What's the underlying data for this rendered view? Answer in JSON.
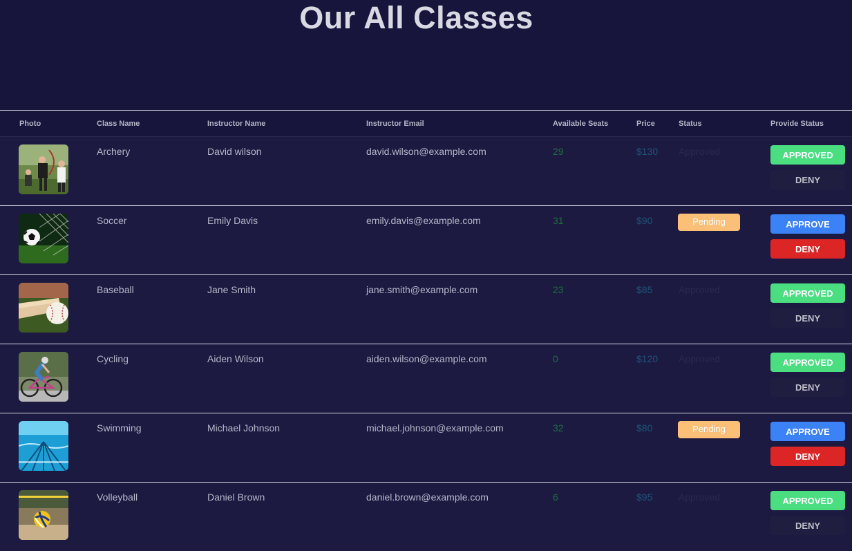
{
  "page_title": "Our All Classes",
  "columns": [
    "Photo",
    "Class Name",
    "Instructor Name",
    "Instructor Email",
    "Available Seats",
    "Price",
    "Status",
    "Provide Status"
  ],
  "colors": {
    "background": "#17153b",
    "row_background": "#1d1a42",
    "approved_button": "#4ade80",
    "approve_button": "#3b82f6",
    "deny_button": "#dc2626",
    "pending_badge": "#fbbf77",
    "seats_text": "#1f6e3e",
    "price_text": "#1c5578"
  },
  "rows": [
    {
      "photo_icon": "archery-photo",
      "class_name": "Archery",
      "instructor": "David wilson",
      "email": "david.wilson@example.com",
      "seats": "29",
      "price": "$130",
      "status": "Approved",
      "approve_label": "APPROVED",
      "deny_label": "DENY"
    },
    {
      "photo_icon": "soccer-photo",
      "class_name": "Soccer",
      "instructor": "Emily Davis",
      "email": "emily.davis@example.com",
      "seats": "31",
      "price": "$90",
      "status": "Pending",
      "approve_label": "APPROVE",
      "deny_label": "DENY"
    },
    {
      "photo_icon": "baseball-photo",
      "class_name": "Baseball",
      "instructor": "Jane Smith",
      "email": "jane.smith@example.com",
      "seats": "23",
      "price": "$85",
      "status": "Approved",
      "approve_label": "APPROVED",
      "deny_label": "DENY"
    },
    {
      "photo_icon": "cycling-photo",
      "class_name": "Cycling",
      "instructor": "Aiden Wilson",
      "email": "aiden.wilson@example.com",
      "seats": "0",
      "price": "$120",
      "status": "Approved",
      "approve_label": "APPROVED",
      "deny_label": "DENY"
    },
    {
      "photo_icon": "swimming-photo",
      "class_name": "Swimming",
      "instructor": "Michael Johnson",
      "email": "michael.johnson@example.com",
      "seats": "32",
      "price": "$80",
      "status": "Pending",
      "approve_label": "APPROVE",
      "deny_label": "DENY"
    },
    {
      "photo_icon": "volleyball-photo",
      "class_name": "Volleyball",
      "instructor": "Daniel Brown",
      "email": "daniel.brown@example.com",
      "seats": "6",
      "price": "$95",
      "status": "Approved",
      "approve_label": "APPROVED",
      "deny_label": "DENY"
    }
  ]
}
